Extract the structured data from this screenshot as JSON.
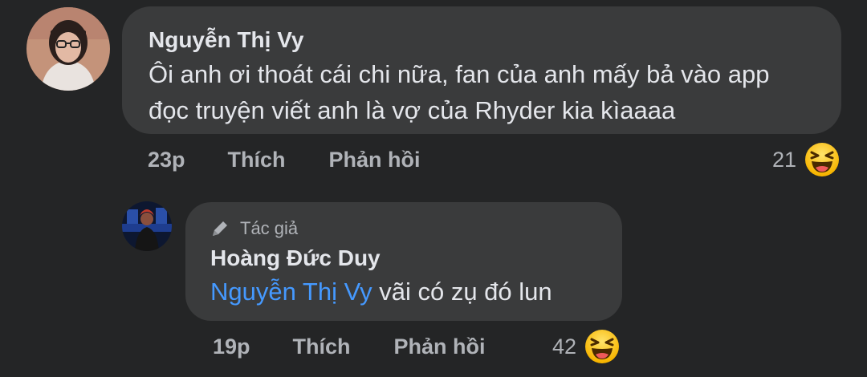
{
  "comment": {
    "author": "Nguyễn Thị Vy",
    "text": "Ôi anh ơi thoát cái chi nữa, fan của anh mấy bả vào app đọc truyện viết anh là vợ của Rhyder kia kìaaaa",
    "time": "23p",
    "like_label": "Thích",
    "reply_label": "Phản hồi",
    "reaction_count": "21",
    "reaction_icon": "laughing-emoji-icon"
  },
  "reply": {
    "author_badge": "Tác giả",
    "badge_icon": "pen-icon",
    "author": "Hoàng Đức Duy",
    "mention": "Nguyễn Thị Vy",
    "text": "vãi có zụ đó lun",
    "time": "19p",
    "like_label": "Thích",
    "reply_label": "Phản hồi",
    "reaction_count": "42",
    "reaction_icon": "laughing-emoji-icon"
  },
  "colors": {
    "background": "#242526",
    "bubble": "#3a3b3c",
    "primary_text": "#e4e6eb",
    "secondary_text": "#b0b3b8",
    "mention": "#4599ff"
  }
}
